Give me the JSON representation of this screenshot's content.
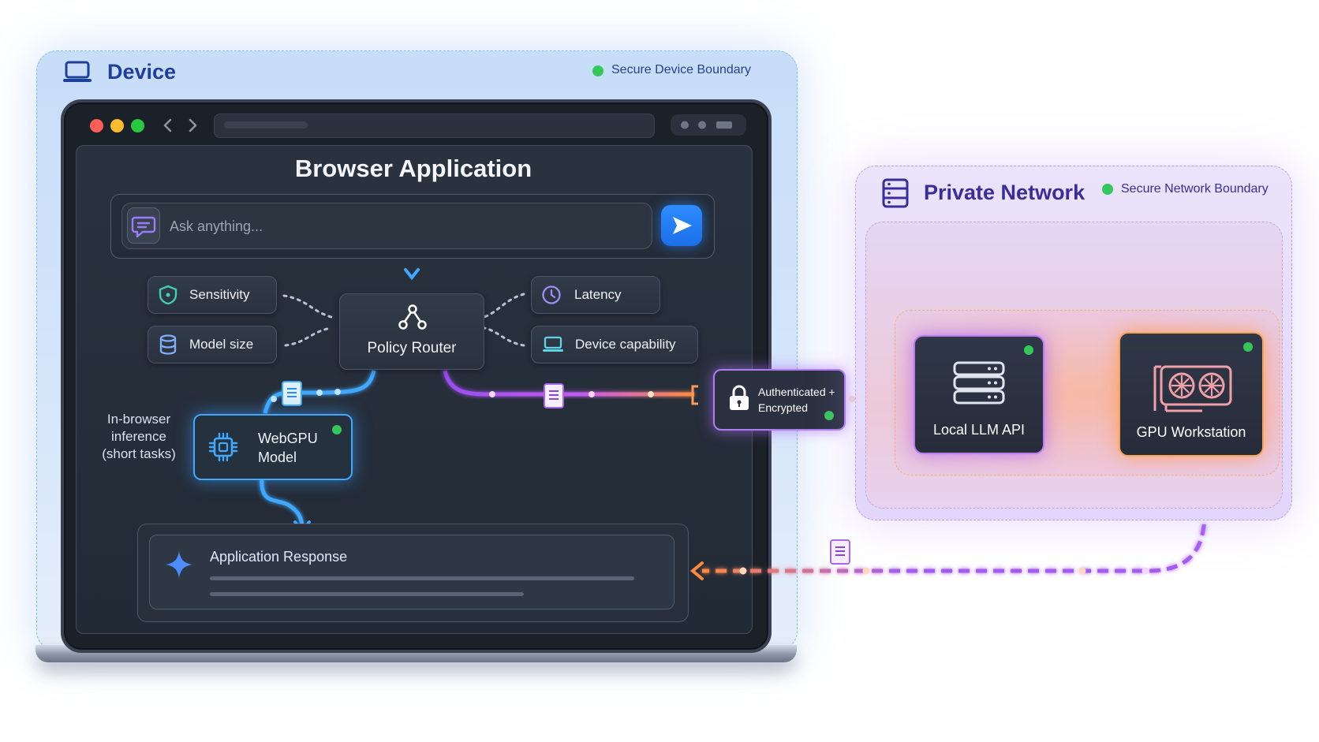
{
  "device": {
    "title": "Device",
    "boundary_label": "Secure Device Boundary",
    "boundary_color": "#34c759"
  },
  "browser": {
    "title": "Browser Application",
    "search_placeholder": "Ask anything..."
  },
  "policy": {
    "router_label": "Policy Router",
    "factors_left": [
      "Sensitivity",
      "Model size"
    ],
    "factors_right": [
      "Latency",
      "Device capability"
    ]
  },
  "webgpu": {
    "label_line1": "WebGPU",
    "label_line2": "Model",
    "note_line1": "In-browser",
    "note_line2": "inference",
    "note_line3": "(short tasks)"
  },
  "response": {
    "label": "Application Response"
  },
  "transport": {
    "line1": "Authenticated +",
    "line2": "Encrypted"
  },
  "network": {
    "title": "Private Network",
    "boundary_label": "Secure Network Boundary",
    "llm_label": "Local LLM API",
    "gpu_label": "GPU Workstation"
  },
  "colors": {
    "device_accent": "#1f3f9c",
    "local_path": "#3fa9ff",
    "remote_path": "#a45cf0",
    "return_path": "#ff8a3d",
    "status_green": "#34c759"
  },
  "icons": [
    "laptop-icon",
    "chat-icon",
    "send-icon",
    "shield-icon",
    "database-icon",
    "router-icon",
    "clock-icon",
    "laptop-small-icon",
    "chip-icon",
    "sparkle-icon",
    "lock-icon",
    "server-rack-icon",
    "server-icon",
    "gpu-icon",
    "document-icon"
  ]
}
